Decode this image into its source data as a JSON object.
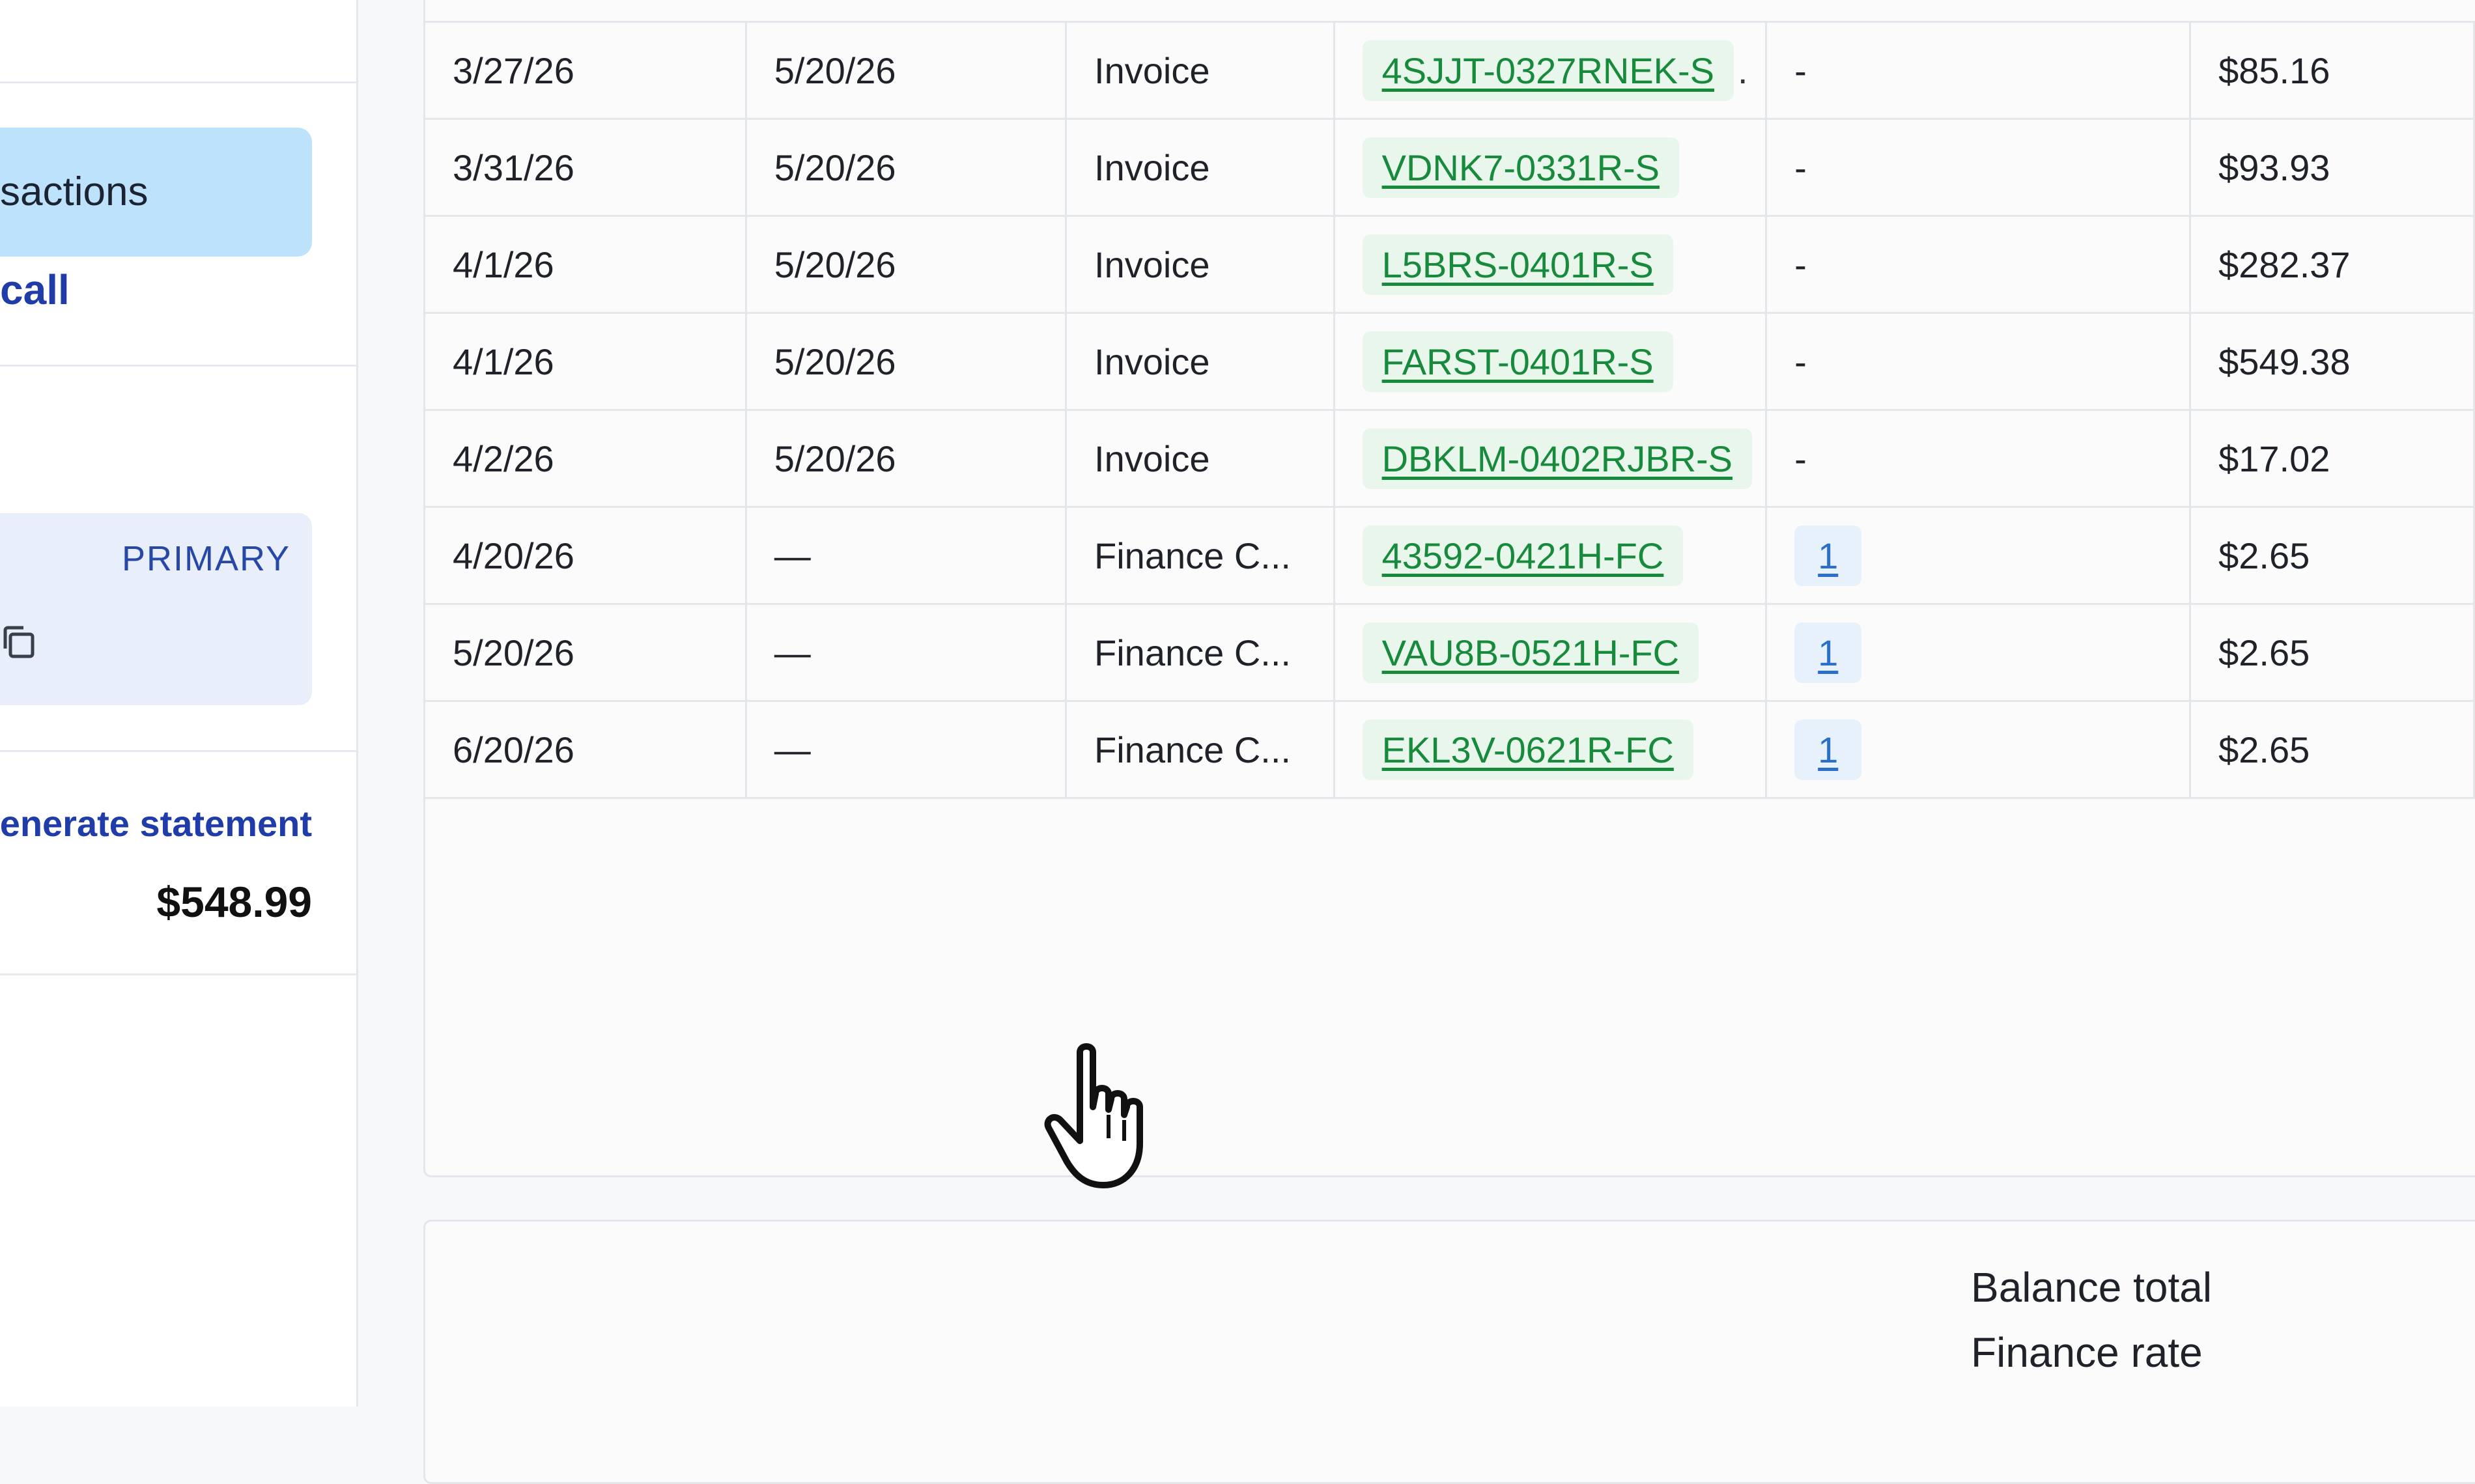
{
  "sidebar": {
    "active_nav_label": "sactions",
    "call_link": "call",
    "primary_badge": "PRIMARY",
    "generate_statement_link": "enerate statement",
    "amount": "$548.99"
  },
  "table": {
    "rows": [
      {
        "date": "3/27/26",
        "due": "5/20/26",
        "type": "Invoice",
        "id": "4SJJT-0327RNEK-S",
        "id_truncated": true,
        "ref": "-",
        "amount": "$85.16"
      },
      {
        "date": "3/31/26",
        "due": "5/20/26",
        "type": "Invoice",
        "id": "VDNK7-0331R-S",
        "id_truncated": false,
        "ref": "-",
        "amount": "$93.93"
      },
      {
        "date": "4/1/26",
        "due": "5/20/26",
        "type": "Invoice",
        "id": "L5BRS-0401R-S",
        "id_truncated": false,
        "ref": "-",
        "amount": "$282.37"
      },
      {
        "date": "4/1/26",
        "due": "5/20/26",
        "type": "Invoice",
        "id": "FARST-0401R-S",
        "id_truncated": false,
        "ref": "-",
        "amount": "$549.38"
      },
      {
        "date": "4/2/26",
        "due": "5/20/26",
        "type": "Invoice",
        "id": "DBKLM-0402RJBR-S",
        "id_truncated": false,
        "ref": "-",
        "amount": "$17.02"
      },
      {
        "date": "4/20/26",
        "due": "—",
        "type": "Finance C...",
        "id": "43592-0421H-FC",
        "id_truncated": false,
        "ref": "1",
        "amount": "$2.65"
      },
      {
        "date": "5/20/26",
        "due": "—",
        "type": "Finance C...",
        "id": "VAU8B-0521H-FC",
        "id_truncated": false,
        "ref": "1",
        "amount": "$2.65"
      },
      {
        "date": "6/20/26",
        "due": "—",
        "type": "Finance C...",
        "id": "EKL3V-0621R-FC",
        "id_truncated": false,
        "ref": "1",
        "amount": "$2.65"
      }
    ],
    "truncation_marker": "."
  },
  "summary": {
    "balance_total_label": "Balance total",
    "finance_rate_label": "Finance rate"
  },
  "icons": {
    "copy": "copy-icon",
    "cursor": "hand-pointer-cursor-icon"
  },
  "colors": {
    "active_nav_bg": "#bde2fb",
    "link_blue": "#1f3ca8",
    "id_chip_bg": "#e9f6ec",
    "id_chip_text": "#178a3c",
    "ref_chip_bg": "#e6f1fb",
    "ref_chip_text": "#2a6fc9"
  }
}
